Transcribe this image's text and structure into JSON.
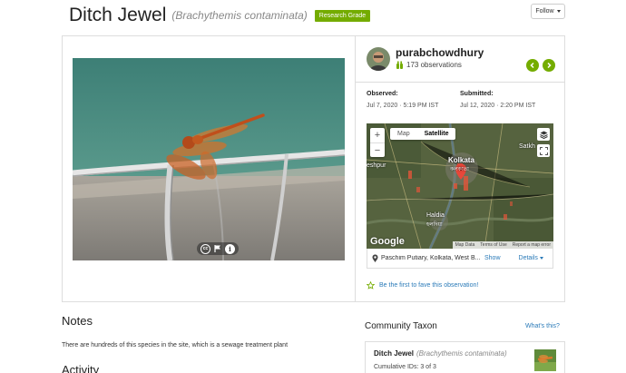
{
  "header": {
    "common_name": "Ditch Jewel",
    "scientific_name": "(Brachythemis contaminata)",
    "grade": "Research Grade",
    "follow_label": "Follow"
  },
  "observer": {
    "username": "purabchowdhury",
    "observations": "173 observations"
  },
  "dates": {
    "observed_label": "Observed:",
    "observed_value": "Jul 7, 2020 · 5:19 PM IST",
    "submitted_label": "Submitted:",
    "submitted_value": "Jul 12, 2020 · 2:20 PM IST"
  },
  "map": {
    "tab_map": "Map",
    "tab_satellite": "Satellite",
    "zoom_in": "+",
    "zoom_out": "−",
    "google": "Google",
    "labels": {
      "kolkata": "Kolkata",
      "kolkata_bn": "কলকাতা",
      "haldia": "Haldia",
      "haldia_bn": "হলদিয়া",
      "satkhira": "Satkh",
      "kshpur": "eshpur"
    },
    "footer": [
      "Map Data",
      "Terms of Use",
      "Report a map error"
    ]
  },
  "place": {
    "name": "Paschim Putiary, Kolkata, West B...",
    "show_label": "Show",
    "details_label": "Details"
  },
  "fave_text": "Be the first to fave this observation!",
  "notes": {
    "title": "Notes",
    "text": "There are hundreds of this species in the site, which is a sewage treatment plant"
  },
  "activity_title": "Activity",
  "community_taxon": {
    "title": "Community Taxon",
    "whats_this": "What's this?",
    "name": "Ditch Jewel",
    "scientific": "(Brachythemis contaminata)",
    "ids": "Cumulative IDs: 3 of 3"
  },
  "colors": {
    "accent_green": "#74ac00",
    "link_blue": "#2a7ab8"
  }
}
